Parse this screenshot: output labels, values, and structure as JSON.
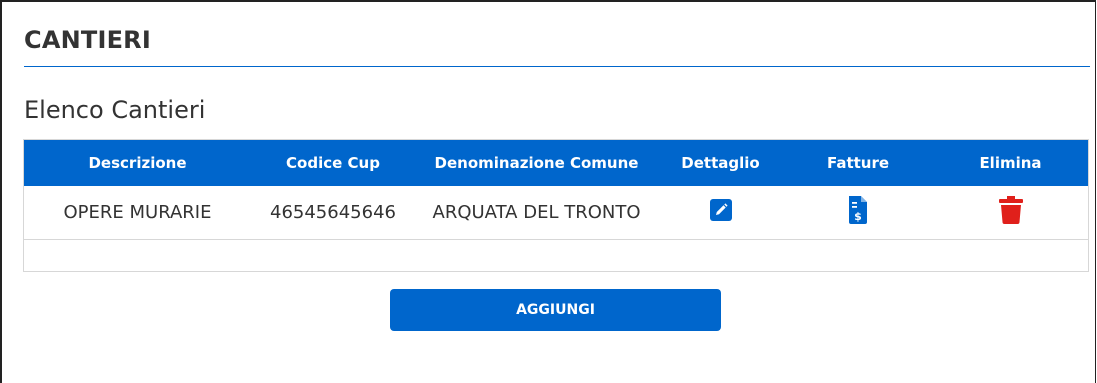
{
  "page": {
    "title": "CANTIERI",
    "section_title": "Elenco Cantieri"
  },
  "table": {
    "columns": [
      "Descrizione",
      "Codice Cup",
      "Denominazione Comune",
      "Dettaglio",
      "Fatture",
      "Elimina"
    ],
    "rows": [
      {
        "descrizione": "OPERE MURARIE",
        "codice_cup": "46545645646",
        "comune": "ARQUATA DEL TRONTO",
        "dettaglio_icon": "edit-icon",
        "fatture_icon": "invoice-icon",
        "elimina_icon": "trash-icon"
      }
    ]
  },
  "actions": {
    "add_label": "AGGIUNGI"
  },
  "colors": {
    "primary": "#0066cc",
    "danger": "#e0201b",
    "text": "#333333"
  }
}
